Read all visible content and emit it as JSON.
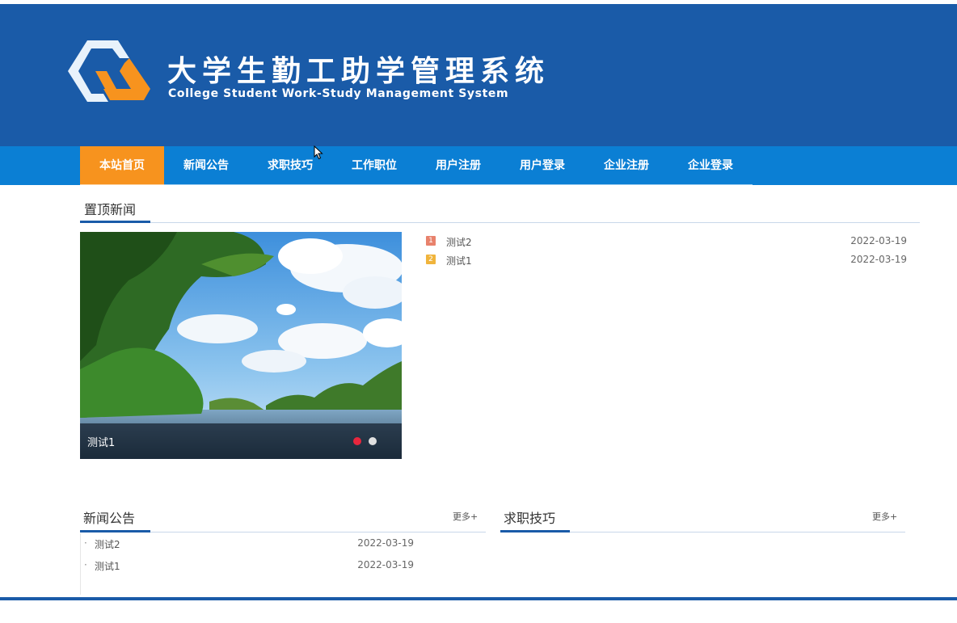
{
  "header": {
    "title_cn": "大学生勤工助学管理系统",
    "title_en": "College Student Work-Study Management System",
    "logo_icon": "hexagon-logo-icon"
  },
  "nav": {
    "items": [
      {
        "label": "本站首页",
        "active": true
      },
      {
        "label": "新闻公告",
        "active": false
      },
      {
        "label": "求职技巧",
        "active": false
      },
      {
        "label": "工作职位",
        "active": false
      },
      {
        "label": "用户注册",
        "active": false
      },
      {
        "label": "用户登录",
        "active": false
      },
      {
        "label": "企业注册",
        "active": false
      },
      {
        "label": "企业登录",
        "active": false
      }
    ]
  },
  "top_news": {
    "title": "置顶新闻",
    "slider": {
      "caption": "测试1",
      "dots": [
        {
          "active": true
        },
        {
          "active": false
        }
      ]
    },
    "items": [
      {
        "rank": "1",
        "title": "测试2",
        "date": "2022-03-19"
      },
      {
        "rank": "2",
        "title": "测试1",
        "date": "2022-03-19"
      }
    ]
  },
  "news": {
    "title": "新闻公告",
    "more": "更多+",
    "items": [
      {
        "bullet": "·",
        "title": "测试2",
        "date": "2022-03-19"
      },
      {
        "bullet": "·",
        "title": "测试1",
        "date": "2022-03-19"
      }
    ]
  },
  "tips": {
    "title": "求职技巧",
    "more": "更多+"
  },
  "colors": {
    "banner": "#1a5ba8",
    "nav": "#0b7fd4",
    "nav_active": "#f7931e",
    "badge_1": "#e8826c",
    "badge_2": "#f0b43c",
    "dot_active": "#e8263d",
    "dot_inactive": "#e0e0e0"
  }
}
